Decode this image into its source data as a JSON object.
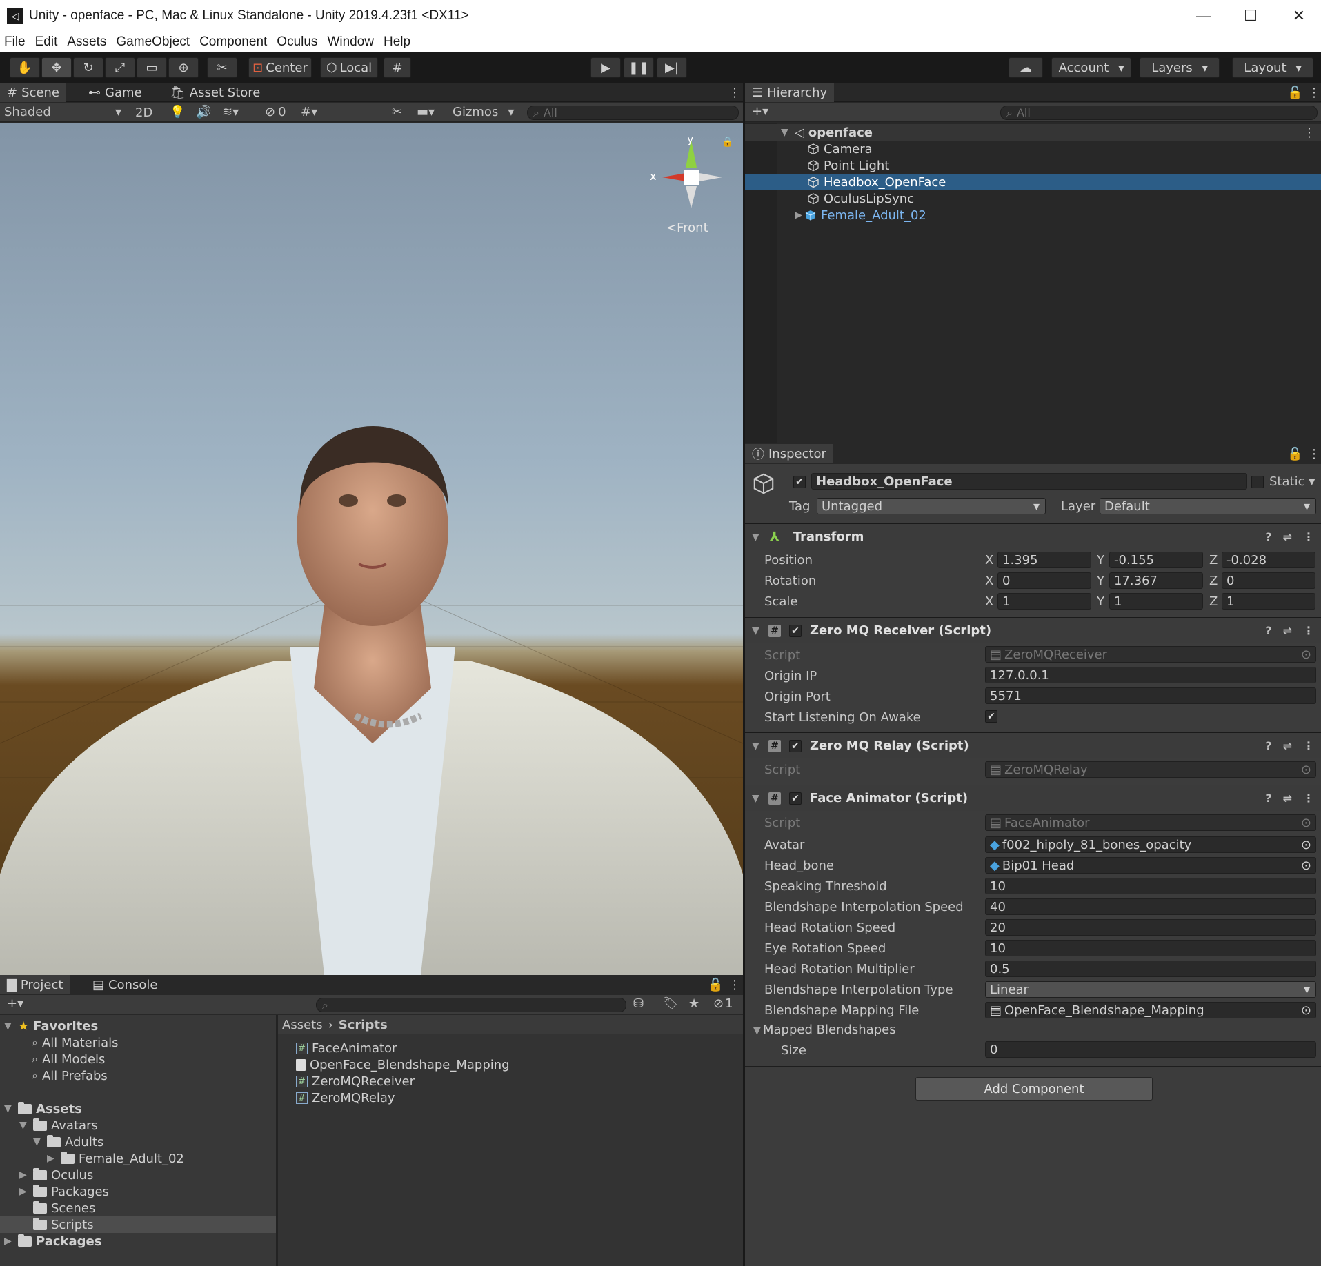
{
  "window": {
    "title": "Unity - openface - PC, Mac & Linux Standalone - Unity 2019.4.23f1 <DX11>"
  },
  "menu": [
    "File",
    "Edit",
    "Assets",
    "GameObject",
    "Component",
    "Oculus",
    "Window",
    "Help"
  ],
  "toolbar": {
    "center": "Center",
    "local": "Local",
    "account": "Account",
    "layers": "Layers",
    "layout": "Layout"
  },
  "scene_panel": {
    "tabs": [
      "Scene",
      "Game",
      "Asset Store"
    ],
    "shading": "Shaded",
    "mode_2d": "2D",
    "hidden_count": "0",
    "gizmos": "Gizmos",
    "search_placeholder": "All",
    "gizmo_y": "y",
    "gizmo_x": "x",
    "gizmo_label": "Front"
  },
  "hierarchy": {
    "tab": "Hierarchy",
    "search_placeholder": "All",
    "scene": "openface",
    "items": [
      "Camera",
      "Point Light",
      "Headbox_OpenFace",
      "OculusLipSync",
      "Female_Adult_02"
    ]
  },
  "inspector": {
    "tab": "Inspector",
    "object_name": "Headbox_OpenFace",
    "static_label": "Static",
    "tag_label": "Tag",
    "tag_value": "Untagged",
    "layer_label": "Layer",
    "layer_value": "Default",
    "transform": {
      "title": "Transform",
      "position_label": "Position",
      "rotation_label": "Rotation",
      "scale_label": "Scale",
      "axes": [
        "X",
        "Y",
        "Z"
      ],
      "position": [
        "1.395",
        "-0.155",
        "-0.028"
      ],
      "rotation": [
        "0",
        "17.367",
        "0"
      ],
      "scale": [
        "1",
        "1",
        "1"
      ]
    },
    "zmq_receiver": {
      "title": "Zero MQ Receiver (Script)",
      "script_label": "Script",
      "script_value": "ZeroMQReceiver",
      "origin_ip_label": "Origin IP",
      "origin_ip": "127.0.0.1",
      "origin_port_label": "Origin Port",
      "origin_port": "5571",
      "listen_label": "Start Listening On Awake"
    },
    "zmq_relay": {
      "title": "Zero MQ Relay (Script)",
      "script_label": "Script",
      "script_value": "ZeroMQRelay"
    },
    "face_animator": {
      "title": "Face Animator (Script)",
      "script_label": "Script",
      "script_value": "FaceAnimator",
      "fields": [
        {
          "label": "Avatar",
          "value": "f002_hipoly_81_bones_opacity"
        },
        {
          "label": "Head_bone",
          "value": "Bip01 Head"
        },
        {
          "label": "Speaking Threshold",
          "value": "10"
        },
        {
          "label": "Blendshape Interpolation Speed",
          "value": "40"
        },
        {
          "label": "Head Rotation Speed",
          "value": "20"
        },
        {
          "label": "Eye Rotation Speed",
          "value": "10"
        },
        {
          "label": "Head Rotation Multiplier",
          "value": "0.5"
        },
        {
          "label": "Blendshape Interpolation Type",
          "value": "Linear"
        },
        {
          "label": "Blendshape Mapping File",
          "value": "OpenFace_Blendshape_Mapping"
        }
      ],
      "mapped_label": "Mapped Blendshapes",
      "size_label": "Size",
      "size_value": "0"
    },
    "add_component": "Add Component"
  },
  "project": {
    "tabs": [
      "Project",
      "Console"
    ],
    "hidden_count": "1",
    "favorites": {
      "label": "Favorites",
      "items": [
        "All Materials",
        "All Models",
        "All Prefabs"
      ]
    },
    "assets_label": "Assets",
    "avatars": "Avatars",
    "adults": "Adults",
    "female": "Female_Adult_02",
    "folders": [
      "Oculus",
      "Packages",
      "Scenes",
      "Scripts"
    ],
    "packages": "Packages",
    "breadcrumb": [
      "Assets",
      "Scripts"
    ],
    "files": [
      "FaceAnimator",
      "OpenFace_Blendshape_Mapping",
      "ZeroMQReceiver",
      "ZeroMQRelay"
    ]
  },
  "colors": {
    "selection": "#2c5d87",
    "panel": "#3c3c3c",
    "background": "#282828"
  }
}
